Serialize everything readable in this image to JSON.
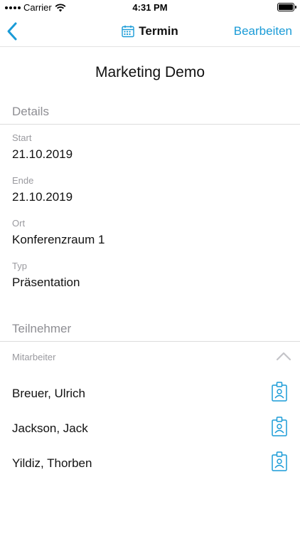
{
  "status_bar": {
    "carrier": "Carrier",
    "time": "4:31 PM"
  },
  "nav": {
    "title": "Termin",
    "edit_label": "Bearbeiten",
    "accent_color": "#1a9bd7"
  },
  "event": {
    "title": "Marketing Demo"
  },
  "details": {
    "header": "Details",
    "fields": [
      {
        "label": "Start",
        "value": "21.10.2019"
      },
      {
        "label": "Ende",
        "value": "21.10.2019"
      },
      {
        "label": "Ort",
        "value": "Konferenzraum 1"
      },
      {
        "label": "Typ",
        "value": "Präsentation"
      }
    ]
  },
  "participants": {
    "header": "Teilnehmer",
    "group_label": "Mitarbeiter",
    "group_expanded": true,
    "people": [
      {
        "name": "Breuer, Ulrich",
        "icon": "contact-badge-icon"
      },
      {
        "name": "Jackson, Jack",
        "icon": "contact-badge-icon"
      },
      {
        "name": "Yildiz, Thorben",
        "icon": "contact-badge-icon"
      }
    ]
  }
}
